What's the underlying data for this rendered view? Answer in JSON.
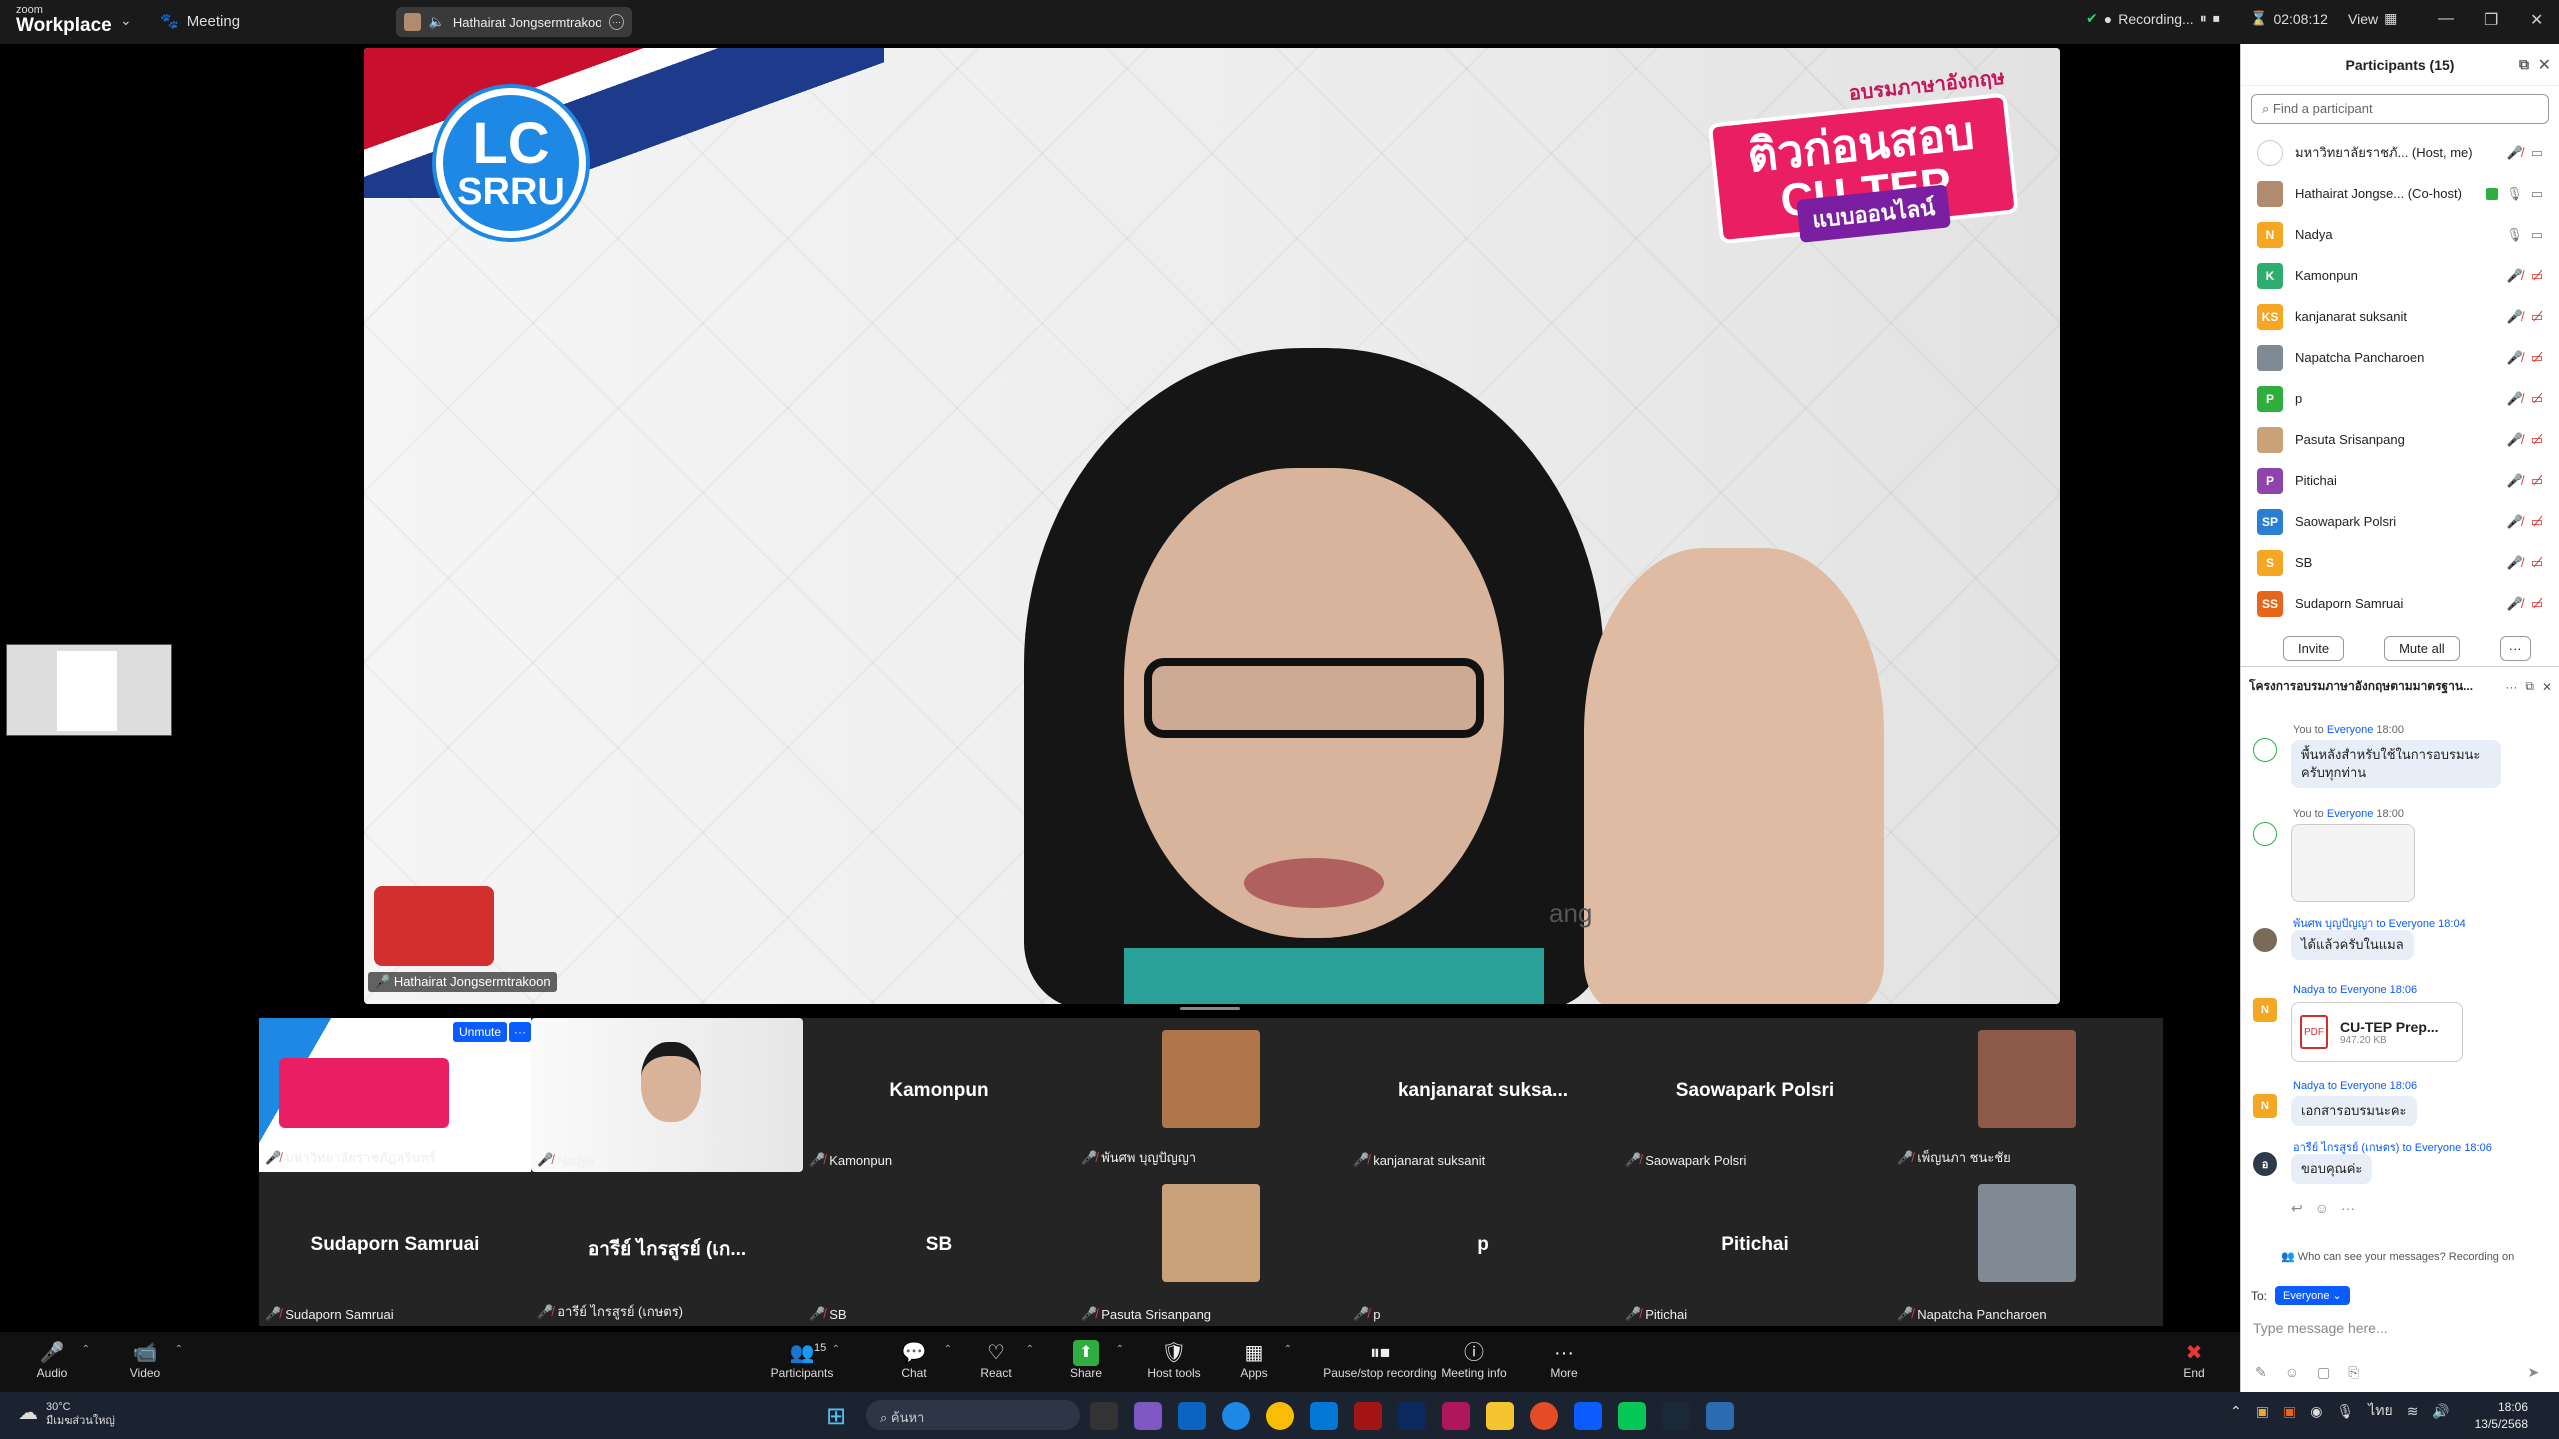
{
  "app": {
    "brand_small": "zoom",
    "brand_big": "Workplace",
    "meeting_label": "Meeting",
    "speaker_chip": "Hathairat Jongsermtrakoon'"
  },
  "topbar_right": {
    "recording": "Recording...",
    "timer": "02:08:12",
    "view": "View"
  },
  "main_video": {
    "name_label": "Hathairat Jongsermtrakoon",
    "badge_line1": "LC",
    "badge_line2": "SRRU",
    "banner_top": "อบรมภาษาอังกฤษ",
    "banner_main": "ติวก่อนสอบ CU-TEP",
    "banner_sub": "แบบออนไลน์",
    "partial_text": "ang"
  },
  "gallery": [
    {
      "name": "",
      "label": "มหาวิทยาลัยราชภัฏสุรินทร์",
      "type": "slide",
      "unmute": "Unmute",
      "more": "···"
    },
    {
      "name": "",
      "label": "Nadya",
      "type": "photo",
      "color": "#cfc8c0"
    },
    {
      "name": "Kamonpun",
      "label": "Kamonpun",
      "type": "name"
    },
    {
      "name": "",
      "label": "พันศพ บุญปัญญา",
      "type": "photo",
      "color": "#b0764a"
    },
    {
      "name": "kanjanarat  suksa...",
      "label": "kanjanarat suksanit",
      "type": "name"
    },
    {
      "name": "Saowapark Polsri",
      "label": "Saowapark Polsri",
      "type": "name"
    },
    {
      "name": "",
      "label": "เพ็ญนภา ชนะชัย",
      "type": "photo",
      "color": "#8d5a4a"
    },
    {
      "name": "Sudaporn Samruai",
      "label": "Sudaporn Samruai",
      "type": "name"
    },
    {
      "name": "อารีย์ ไกรสูรย์ (เก...",
      "label": "อารีย์ ไกรสูรย์ (เกษตร)",
      "type": "name"
    },
    {
      "name": "SB",
      "label": "SB",
      "type": "name"
    },
    {
      "name": "",
      "label": "Pasuta Srisanpang",
      "type": "photo",
      "color": "#c9a27a"
    },
    {
      "name": "p",
      "label": "p",
      "type": "name"
    },
    {
      "name": "Pitichai",
      "label": "Pitichai",
      "type": "name"
    },
    {
      "name": "",
      "label": "Napatcha Pancharoen",
      "type": "photo",
      "color": "#7f8a94"
    }
  ],
  "toolbar": [
    {
      "label": "Audio",
      "icon": "🎤",
      "caret": true
    },
    {
      "label": "Video",
      "icon": "📹",
      "caret": true
    },
    {
      "label": "Participants",
      "icon": "👥",
      "count": "15",
      "caret": true
    },
    {
      "label": "Chat",
      "icon": "💬",
      "caret": true
    },
    {
      "label": "React",
      "icon": "♡",
      "caret": true
    },
    {
      "label": "Share",
      "icon": "⬆",
      "caret": true
    },
    {
      "label": "Host tools",
      "icon": "🛡",
      "caret": false
    },
    {
      "label": "Apps",
      "icon": "▦",
      "caret": true
    },
    {
      "label": "Pause/stop recording",
      "icon": "⏸⏹",
      "caret": false
    },
    {
      "label": "Meeting info",
      "icon": "ⓘ",
      "caret": false
    },
    {
      "label": "More",
      "icon": "···",
      "caret": false
    },
    {
      "label": "End",
      "icon": "✖",
      "caret": false
    }
  ],
  "participants_panel": {
    "title": "Participants (15)",
    "search_placeholder": "Find a participant",
    "rows": [
      {
        "name": "มหาวิทยาลัยราชภั...  (Host, me)",
        "initials": "",
        "color": "#ffffff",
        "mic": "muted"
      },
      {
        "name": "Hathairat Jongse...  (Co-host)",
        "initials": "",
        "color": "#b08b6e",
        "mic": "on"
      },
      {
        "name": "Nadya",
        "initials": "N",
        "color": "#f5a623",
        "mic": "on"
      },
      {
        "name": "Kamonpun",
        "initials": "K",
        "color": "#2eae6e",
        "mic": "muted"
      },
      {
        "name": "kanjanarat suksanit",
        "initials": "KS",
        "color": "#f5a623",
        "mic": "muted"
      },
      {
        "name": "Napatcha Pancharoen",
        "initials": "",
        "color": "#7f8a94",
        "mic": "muted"
      },
      {
        "name": "p",
        "initials": "P",
        "color": "#2eae3e",
        "mic": "muted"
      },
      {
        "name": "Pasuta Srisanpang",
        "initials": "",
        "color": "#c9a27a",
        "mic": "muted"
      },
      {
        "name": "Pitichai",
        "initials": "P",
        "color": "#8e44ad",
        "mic": "muted"
      },
      {
        "name": "Saowapark Polsri",
        "initials": "SP",
        "color": "#2a7fd4",
        "mic": "muted"
      },
      {
        "name": "SB",
        "initials": "S",
        "color": "#f5a623",
        "mic": "muted"
      },
      {
        "name": "Sudaporn Samruai",
        "initials": "SS",
        "color": "#e8651c",
        "mic": "muted"
      }
    ],
    "invite": "Invite",
    "mute_all": "Mute all",
    "more": "···"
  },
  "chat": {
    "title": "โครงการอบรมภาษาอังกฤษตามมาตรฐาน...",
    "messages": [
      {
        "from": "You",
        "to": "Everyone",
        "time": "18:00",
        "text": "พื้นหลังสำหรับใช้ในการอบรมนะครับทุกท่าน",
        "kind": "text"
      },
      {
        "from": "You",
        "to": "Everyone",
        "time": "18:00",
        "text": "",
        "kind": "image"
      },
      {
        "from": "พันศพ บุญปัญญา",
        "to": "Everyone",
        "time": "18:04",
        "text": "ได้แล้วครับในแมล",
        "kind": "text"
      },
      {
        "from": "Nadya",
        "to": "Everyone",
        "time": "18:06",
        "text": "",
        "kind": "file",
        "file_name": "CU-TEP Prep...",
        "file_size": "947.20 KB"
      },
      {
        "from": "Nadya",
        "to": "Everyone",
        "time": "18:06",
        "text": "เอกสารอบรมนะคะ",
        "kind": "text"
      },
      {
        "from": "อารีย์ ไกรสูรย์ (เกษตร)",
        "to": "Everyone",
        "time": "18:06",
        "text": "ขอบคุณค่ะ",
        "kind": "text"
      }
    ],
    "who_can_see": "Who can see your messages? Recording on",
    "to_label": "To:",
    "to_value": "Everyone",
    "input_placeholder": "Type message here..."
  },
  "taskbar": {
    "temp": "30°C",
    "weather": "มีเมฆส่วนใหญ่",
    "search": "ค้นหา",
    "lang": "ไทย",
    "time": "18:06",
    "date": "13/5/2568"
  }
}
